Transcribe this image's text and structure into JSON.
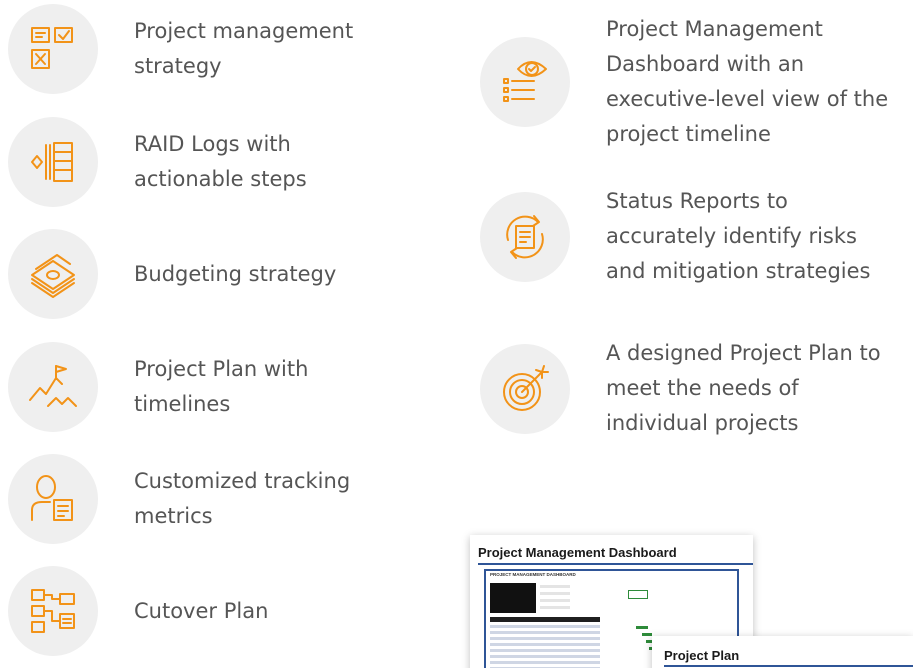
{
  "features_left": [
    {
      "label": "Project management strategy",
      "icon": "checklist-boards-icon"
    },
    {
      "label": "RAID Logs with actionable steps",
      "icon": "log-stack-icon"
    },
    {
      "label": "Budgeting strategy",
      "icon": "money-stack-icon"
    },
    {
      "label": "Project Plan with timelines",
      "icon": "mountain-flag-icon"
    },
    {
      "label": "Customized tracking metrics",
      "icon": "person-note-icon"
    },
    {
      "label": "Cutover Plan",
      "icon": "flowchart-icon"
    }
  ],
  "features_right": [
    {
      "label": "Project Management Dashboard with an executive-level view of the project timeline",
      "icon": "eye-checklist-icon"
    },
    {
      "label": "Status Reports to accurately identify risks and mitigation strategies",
      "icon": "cycle-document-icon"
    },
    {
      "label": "A designed Project Plan to meet the needs of individual projects",
      "icon": "target-arrow-icon"
    }
  ],
  "thumbnails": {
    "dashboard_title": "Project Management Dashboard",
    "dashboard_inner_title": "PROJECT MANAGEMENT DASHBOARD",
    "plan_title": "Project Plan"
  },
  "colors": {
    "accent": "#f29318",
    "circle": "#efefef",
    "text": "#555555"
  }
}
